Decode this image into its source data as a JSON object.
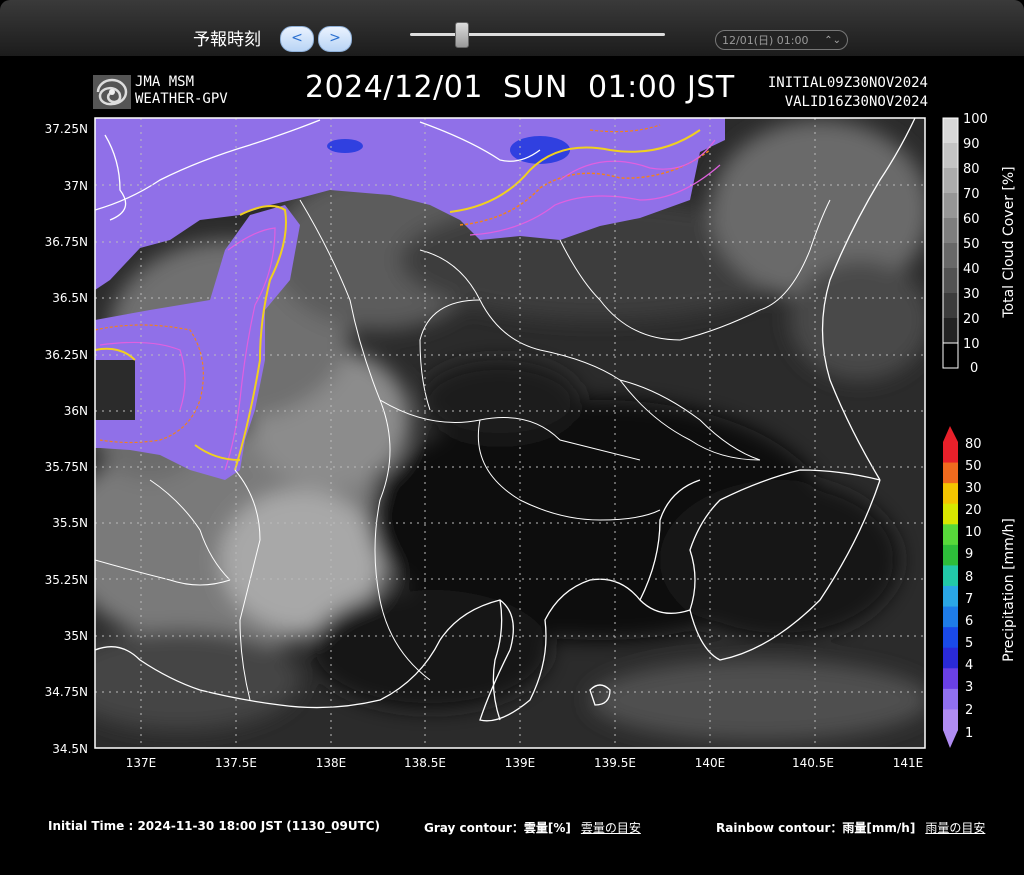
{
  "toolbar": {
    "label": "予報時刻",
    "prev_label": "<",
    "next_label": ">",
    "slider_value_fraction": 0.2,
    "selected_time": "12/01(日) 01:00"
  },
  "header": {
    "logo_line1": "JMA MSM",
    "logo_line2": "WEATHER-GPV",
    "title": "2024/12/01  SUN  01:00 JST",
    "initial": "INITIAL09Z30NOV2024",
    "valid": "VALID16Z30NOV2024"
  },
  "map": {
    "lat_labels": [
      "37.25N",
      "37N",
      "36.75N",
      "36.5N",
      "36.25N",
      "36N",
      "35.75N",
      "35.5N",
      "35.25N",
      "35N",
      "34.75N",
      "34.5N"
    ],
    "lon_labels": [
      "137E",
      "137.5E",
      "138E",
      "138.5E",
      "139E",
      "139.5E",
      "140E",
      "140.5E",
      "141E"
    ]
  },
  "cloud_legend": {
    "title": "Total Cloud Cover [%]",
    "levels": [
      "100",
      "90",
      "80",
      "70",
      "60",
      "50",
      "40",
      "30",
      "20",
      "10",
      "0"
    ]
  },
  "precip_legend": {
    "title": "Precipitation [mm/h]",
    "levels": [
      "80",
      "50",
      "30",
      "20",
      "10",
      "9",
      "8",
      "7",
      "6",
      "5",
      "4",
      "3",
      "2",
      "1"
    ],
    "colors": [
      "#e8202a",
      "#f06a1e",
      "#f4c400",
      "#d8e600",
      "#58d83a",
      "#2ebd3a",
      "#22c8a8",
      "#2aa6e6",
      "#1e7ce8",
      "#1a4ae8",
      "#2a2ad8",
      "#6a40e6",
      "#9070f0",
      "#b08cf2"
    ]
  },
  "footer": {
    "initial_time": "Initial Time : 2024-11-30 18:00 JST (1130_09UTC)",
    "gray_contour": "Gray contour：雲量[%]",
    "gray_link": "雲量の目安",
    "rainbow_contour": "Rainbow contour：雨量[mm/h]",
    "rainbow_link": "雨量の目安"
  },
  "colors": {
    "precip_purple": "#9070e8",
    "contour_yellow": "#f0d020",
    "contour_orange": "#f08020",
    "contour_pink": "#e060e0"
  }
}
